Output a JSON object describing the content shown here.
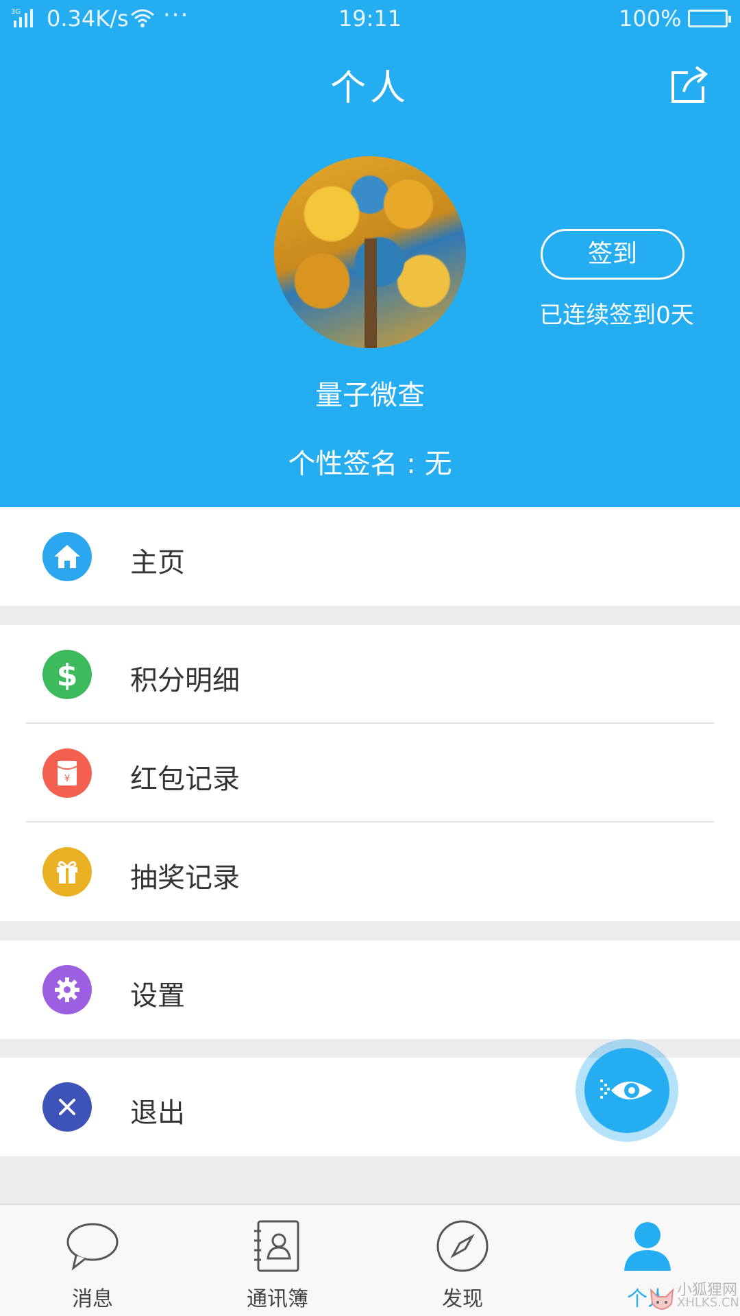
{
  "status_bar": {
    "signal": "3G",
    "network_speed": "0.34K/s",
    "more": "···",
    "time": "19:11",
    "battery": "100%"
  },
  "header": {
    "title": "个人",
    "share_icon": "share-icon"
  },
  "profile": {
    "avatar": "avatar-tree-photo",
    "username": "量子微查",
    "signature": "个性签名 : 无",
    "checkin_label": "签到",
    "checkin_days": "已连续签到0天"
  },
  "menu": {
    "home": {
      "label": "主页",
      "icon": "home-icon",
      "color": "#2aa7ee"
    },
    "points": {
      "label": "积分明细",
      "icon": "dollar-icon",
      "color": "#3dbb5c"
    },
    "redpacket": {
      "label": "红包记录",
      "icon": "red-envelope-icon",
      "color": "#f4604f"
    },
    "lottery": {
      "label": "抽奖记录",
      "icon": "gift-icon",
      "color": "#ebb124"
    },
    "settings": {
      "label": "设置",
      "icon": "gear-icon",
      "color": "#9c5fe2"
    },
    "logout": {
      "label": "退出",
      "icon": "close-icon",
      "color": "#3d53b7"
    }
  },
  "tabbar": {
    "messages": "消息",
    "contacts": "通讯簿",
    "discover": "发现",
    "me": "个人",
    "active_color": "#25adf1"
  },
  "watermark": {
    "cn": "小狐狸网",
    "en": "XHLKS.CN"
  }
}
